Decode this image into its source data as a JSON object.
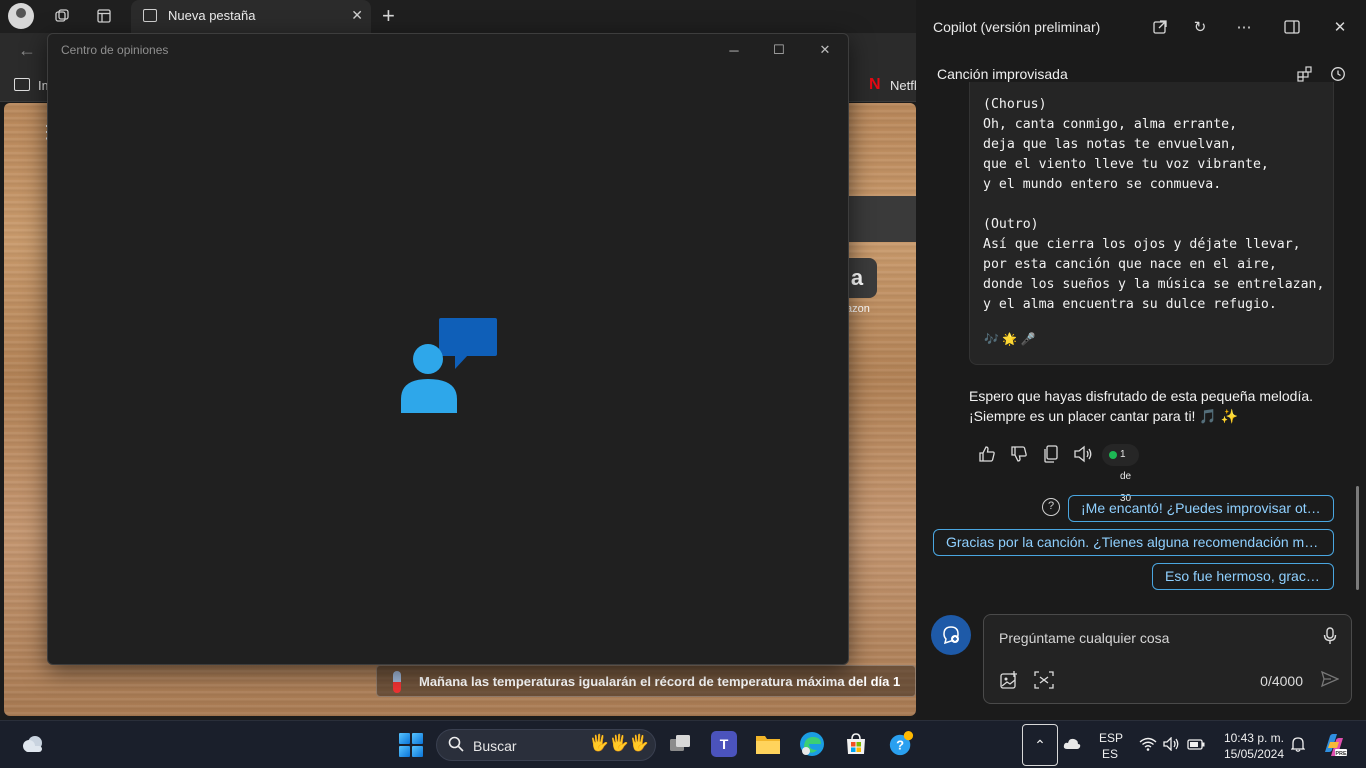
{
  "browser": {
    "tab": {
      "title": "Nueva pestaña"
    },
    "favorites": {
      "item1": "Im",
      "item2": ".",
      "netflix": "Netfl"
    }
  },
  "newtab_page": {
    "amazon_label": "azon",
    "amazon_glyph": "a",
    "news": {
      "text": "Mañana las temperaturas igualarán el récord de temperatura máxima ",
      "bold": "del día 1"
    }
  },
  "feedback_window": {
    "title": "Centro de opiniones"
  },
  "copilot": {
    "title": "Copilot (versión preliminar)",
    "conversation_title": "Canción improvisada",
    "song_lines": "(Chorus)\nOh, canta conmigo, alma errante,\ndeja que las notas te envuelvan,\nque el viento lleve tu voz vibrante,\ny el mundo entero se conmueva.\n\n(Outro)\nAsí que cierra los ojos y déjate llevar,\npor esta canción que nace en el aire,\ndonde los sueños y la música se entrelazan,\ny el alma encuentra su dulce refugio.",
    "song_emojis": "🎶 🌟 🎤",
    "message": "Espero que hayas disfrutado de esta pequeña melodía. ¡Siempre es un placer cantar para ti! 🎵 ✨",
    "response_counter": "1 de 30",
    "suggestions": [
      "¡Me encantó! ¿Puedes improvisar otra?",
      "Gracias por la canción. ¿Tienes alguna recomendación musical?",
      "Eso fue hermoso, gracias."
    ],
    "composer": {
      "placeholder": "Pregúntame cualquier cosa",
      "char_count": "0/4000"
    }
  },
  "taskbar": {
    "search_label": "Buscar",
    "language": "ESP",
    "layout": "ES",
    "time": "10:43 p. m.",
    "date": "15/05/2024"
  },
  "colors": {
    "accent": "#4aa6e0",
    "copilot_bg": "#1b1b1b",
    "feedback_bg": "#202020",
    "taskbar_bg": "#1a1f2b"
  }
}
